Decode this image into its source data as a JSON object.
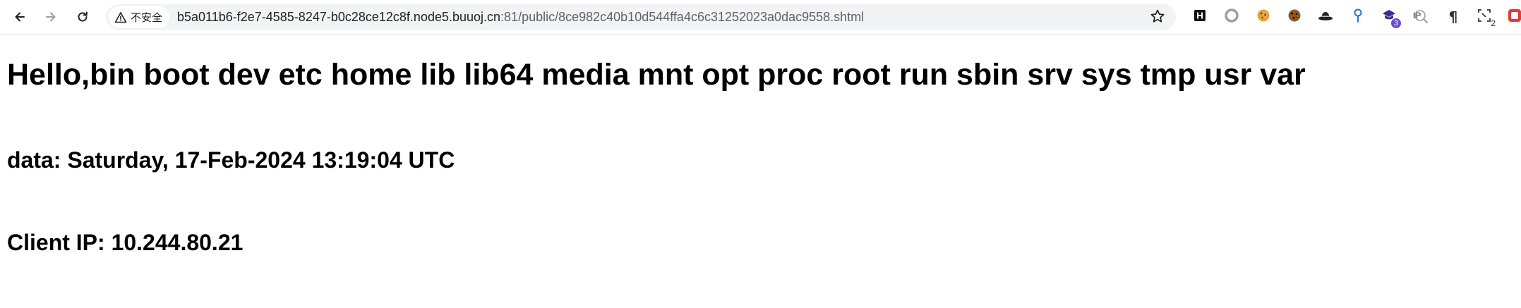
{
  "browser": {
    "security_label": "不安全",
    "url_host": "b5a011b6-f2e7-4585-8247-b0c28ce12c8f.node5.buuoj.cn",
    "url_rest": ":81/public/8ce982c40b10d544ffa4c6c31252023a0dac9558.shtml",
    "extensions": [
      {
        "icon": "h-box-icon"
      },
      {
        "icon": "circle-icon"
      },
      {
        "icon": "cookie-icon"
      },
      {
        "icon": "cookie-dark-icon"
      },
      {
        "icon": "hat-icon"
      },
      {
        "icon": "pin-icon"
      },
      {
        "icon": "purple-badge-icon",
        "badge": "3"
      },
      {
        "icon": "ip-icon",
        "label": "IP"
      },
      {
        "icon": "pilcrow-icon",
        "label": "¶"
      },
      {
        "icon": "screenshot-icon",
        "badge": "2"
      }
    ]
  },
  "page": {
    "heading": "Hello,bin boot dev etc home lib lib64 media mnt opt proc root run sbin srv sys tmp usr var",
    "date_line": "data: Saturday, 17-Feb-2024 13:19:04 UTC",
    "ip_line": "Client IP: 10.244.80.21"
  }
}
